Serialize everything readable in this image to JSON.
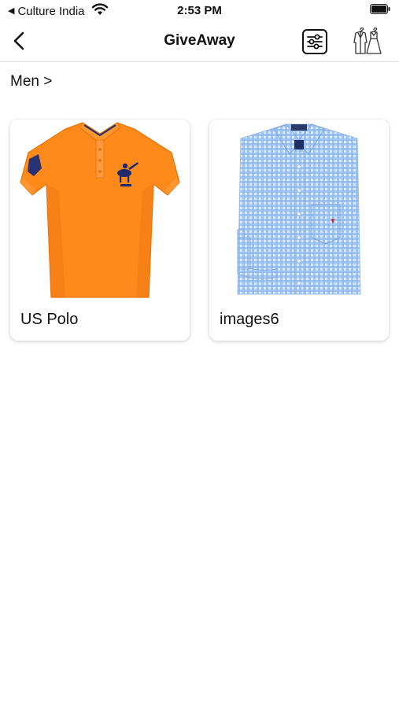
{
  "status_bar": {
    "back_app": "Culture India",
    "time": "2:53 PM"
  },
  "nav": {
    "title": "GiveAway",
    "back_icon": "chevron-left-icon",
    "filter_icon": "sliders-icon",
    "wardrobe_icon": "clothes-icon"
  },
  "breadcrumb": "Men >",
  "items": [
    {
      "label": "US Polo",
      "image": "orange-polo-shirt",
      "color": "#ff8c1a"
    },
    {
      "label": "images6",
      "image": "blue-checked-shirt",
      "color": "#8db8ea"
    }
  ]
}
